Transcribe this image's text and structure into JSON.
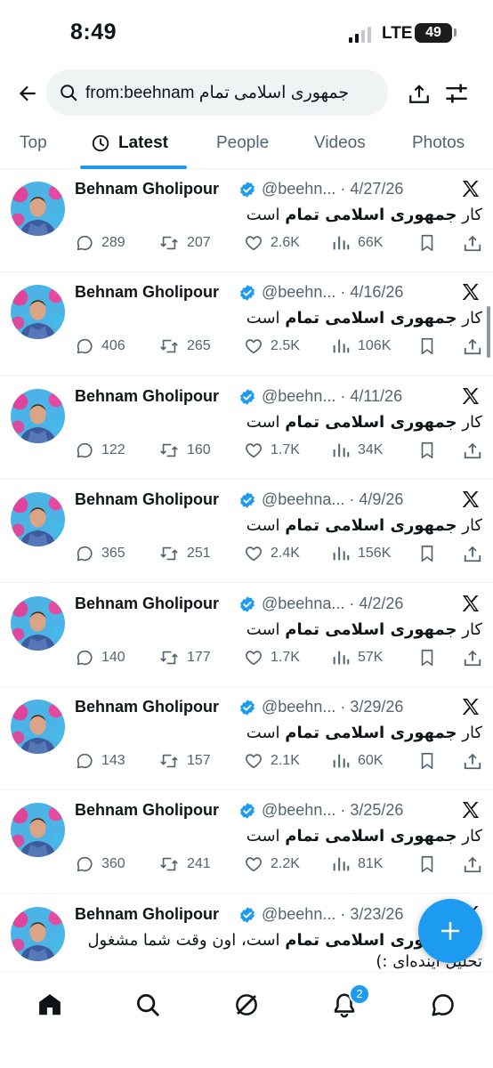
{
  "status_bar": {
    "time": "8:49",
    "network": "LTE",
    "battery": "49"
  },
  "search": {
    "query": "from:beehnam جمهوری اسلامی تمام"
  },
  "tabs": [
    {
      "label": "Top"
    },
    {
      "label": "Latest"
    },
    {
      "label": "People"
    },
    {
      "label": "Videos"
    },
    {
      "label": "Photos"
    }
  ],
  "tweets": [
    {
      "name": "Behnam Gholipour",
      "handle": "@beehn...",
      "date": "· 4/27/26",
      "text_pre": "کار ",
      "text_bold": "جمهوری اسلامی تمام",
      "text_post": " است",
      "replies": "289",
      "reposts": "207",
      "likes": "2.6K",
      "views": "66K"
    },
    {
      "name": "Behnam Gholipour",
      "handle": "@beehn...",
      "date": "· 4/16/26",
      "text_pre": "کار ",
      "text_bold": "جمهوری اسلامی تمام",
      "text_post": " است",
      "replies": "406",
      "reposts": "265",
      "likes": "2.5K",
      "views": "106K"
    },
    {
      "name": "Behnam Gholipour",
      "handle": "@beehn...",
      "date": "· 4/11/26",
      "text_pre": "کار ",
      "text_bold": "جمهوری اسلامی تمام",
      "text_post": " است",
      "replies": "122",
      "reposts": "160",
      "likes": "1.7K",
      "views": "34K"
    },
    {
      "name": "Behnam Gholipour",
      "handle": "@beehna...",
      "date": "· 4/9/26",
      "text_pre": "کار ",
      "text_bold": "جمهوری اسلامی تمام",
      "text_post": " است",
      "replies": "365",
      "reposts": "251",
      "likes": "2.4K",
      "views": "156K"
    },
    {
      "name": "Behnam Gholipour",
      "handle": "@beehna...",
      "date": "· 4/2/26",
      "text_pre": "کار ",
      "text_bold": "جمهوری اسلامی تمام",
      "text_post": " است",
      "replies": "140",
      "reposts": "177",
      "likes": "1.7K",
      "views": "57K"
    },
    {
      "name": "Behnam Gholipour",
      "handle": "@beehn...",
      "date": "· 3/29/26",
      "text_pre": "کار ",
      "text_bold": "جمهوری اسلامی تمام",
      "text_post": " است",
      "replies": "143",
      "reposts": "157",
      "likes": "2.1K",
      "views": "60K"
    },
    {
      "name": "Behnam Gholipour",
      "handle": "@beehn...",
      "date": "· 3/25/26",
      "text_pre": "کار ",
      "text_bold": "جمهوری اسلامی تمام",
      "text_post": " است",
      "replies": "360",
      "reposts": "241",
      "likes": "2.2K",
      "views": "81K"
    },
    {
      "name": "Behnam Gholipour",
      "handle": "@beehn...",
      "date": "· 3/23/26",
      "text_pre": "کار ",
      "text_bold": "جمهوری اسلامی تمام",
      "text_post": " است، اون وقت شما مشغول تحلیل آینده‌ای :)",
      "replies": "",
      "reposts": "",
      "likes": "",
      "views": ""
    }
  ],
  "notifications_badge": "2",
  "colors": {
    "accent": "#1d9bf0",
    "text": "#0f1419",
    "secondary": "#536471"
  },
  "icons": [
    "back-arrow-icon",
    "search-icon",
    "share-icon",
    "filter-icon",
    "clock-icon",
    "verified-icon",
    "x-logo-icon",
    "reply-icon",
    "repost-icon",
    "like-icon",
    "views-icon",
    "bookmark-icon",
    "home-icon",
    "explore-icon",
    "grok-icon",
    "bell-icon",
    "messages-icon",
    "plus-icon"
  ]
}
